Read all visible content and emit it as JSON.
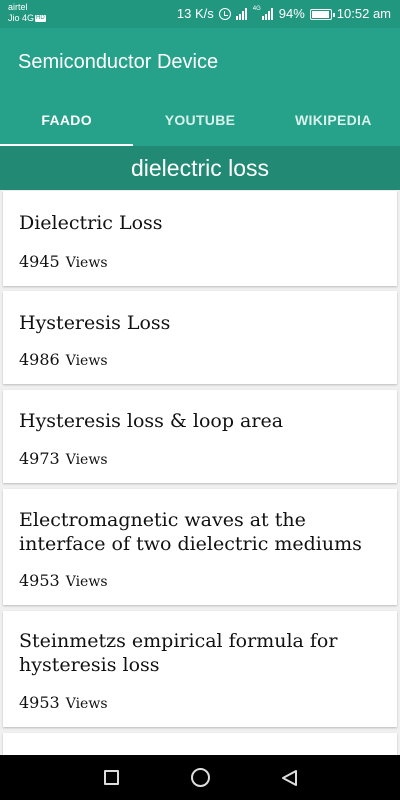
{
  "status_bar": {
    "carrier_line1": "airtel",
    "carrier_line2": "Jio 4G",
    "lte_badge": "HD",
    "net_speed": "13 K/s",
    "net_type": "4G",
    "battery": "94%",
    "battery_level": 0.94,
    "time": "10:52 am",
    "icons": [
      "alarm-icon",
      "signal-icon",
      "battery-icon"
    ]
  },
  "app_bar": {
    "title": "Semiconductor Device"
  },
  "tabs": [
    {
      "label": "FAADO",
      "active": true
    },
    {
      "label": "YOUTUBE",
      "active": false
    },
    {
      "label": "WIKIPEDIA",
      "active": false
    }
  ],
  "search_header": {
    "query": "dielectric loss"
  },
  "cards": [
    {
      "title": "Dielectric Loss",
      "views": "4945",
      "views_label": "Views"
    },
    {
      "title": "Hysteresis Loss",
      "views": "4986",
      "views_label": "Views"
    },
    {
      "title": "Hysteresis loss & loop area",
      "views": "4973",
      "views_label": "Views"
    },
    {
      "title": "Electromagnetic waves at the interface of two dielectric mediums",
      "views": "4953",
      "views_label": "Views"
    },
    {
      "title": "Steinmetzs empirical formula for hysteresis loss",
      "views": "4953",
      "views_label": "Views"
    }
  ],
  "nav_bar": {
    "icons": [
      "recents-square-icon",
      "home-circle-icon",
      "back-triangle-icon"
    ]
  },
  "colors": {
    "status_bar": "#22977f",
    "app_bar": "#26a18a",
    "search_header": "#228a74",
    "background": "#f0f0f0"
  }
}
